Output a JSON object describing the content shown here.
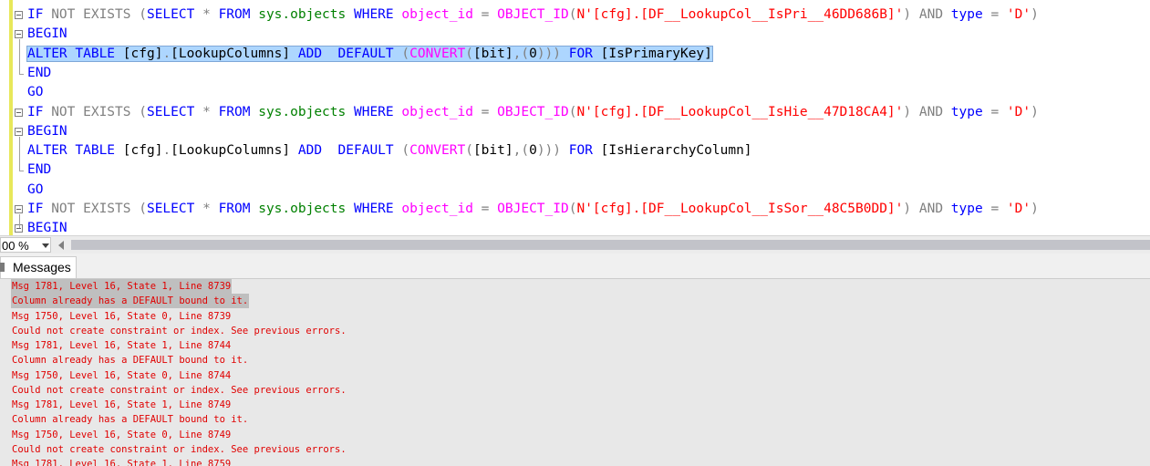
{
  "editor": {
    "lines": [
      {
        "indent": 0,
        "fold": true,
        "tokens": [
          {
            "t": "IF",
            "c": "kw"
          },
          {
            "t": " NOT EXISTS ",
            "c": "gr"
          },
          {
            "t": "(",
            "c": "gr"
          },
          {
            "t": "SELECT",
            "c": "kw"
          },
          {
            "t": " * ",
            "c": "gr"
          },
          {
            "t": "FROM",
            "c": "kw"
          },
          {
            "t": " ",
            "c": "bl"
          },
          {
            "t": "sys.objects",
            "c": "sy"
          },
          {
            "t": " ",
            "c": "bl"
          },
          {
            "t": "WHERE",
            "c": "kw"
          },
          {
            "t": " ",
            "c": "bl"
          },
          {
            "t": "object_id",
            "c": "fn"
          },
          {
            "t": " = ",
            "c": "gr"
          },
          {
            "t": "OBJECT_ID",
            "c": "fn"
          },
          {
            "t": "(",
            "c": "gr"
          },
          {
            "t": "N'[cfg].[DF__LookupCol__IsPri__46DD686B]'",
            "c": "st"
          },
          {
            "t": ") ",
            "c": "gr"
          },
          {
            "t": "AND",
            "c": "gr"
          },
          {
            "t": " ",
            "c": "bl"
          },
          {
            "t": "type",
            "c": "kw"
          },
          {
            "t": " = ",
            "c": "gr"
          },
          {
            "t": "'D'",
            "c": "st"
          },
          {
            "t": ")",
            "c": "gr"
          }
        ]
      },
      {
        "indent": 0,
        "fold": true,
        "tokens": [
          {
            "t": "BEGIN",
            "c": "kw"
          }
        ]
      },
      {
        "indent": 0,
        "fold": false,
        "selected": true,
        "tokens": [
          {
            "t": "ALTER",
            "c": "kw"
          },
          {
            "t": " ",
            "c": "bl"
          },
          {
            "t": "TABLE",
            "c": "kw"
          },
          {
            "t": " [cfg]",
            "c": "bl"
          },
          {
            "t": ".",
            "c": "gr"
          },
          {
            "t": "[LookupColumns] ",
            "c": "bl"
          },
          {
            "t": "ADD",
            "c": "kw"
          },
          {
            "t": "  ",
            "c": "bl"
          },
          {
            "t": "DEFAULT",
            "c": "kw"
          },
          {
            "t": " ",
            "c": "bl"
          },
          {
            "t": "(",
            "c": "gr"
          },
          {
            "t": "CONVERT",
            "c": "fn"
          },
          {
            "t": "(",
            "c": "gr"
          },
          {
            "t": "[bit]",
            "c": "bl"
          },
          {
            "t": ",(",
            "c": "gr"
          },
          {
            "t": "0",
            "c": "bl"
          },
          {
            "t": "))) ",
            "c": "gr"
          },
          {
            "t": "FOR",
            "c": "kw"
          },
          {
            "t": " [IsPrimaryKey]",
            "c": "bl"
          }
        ]
      },
      {
        "indent": 0,
        "fold": false,
        "tokens": [
          {
            "t": "END",
            "c": "kw"
          }
        ]
      },
      {
        "indent": 0,
        "fold": false,
        "tokens": [
          {
            "t": "GO",
            "c": "kw"
          }
        ]
      },
      {
        "indent": 0,
        "fold": true,
        "tokens": [
          {
            "t": "IF",
            "c": "kw"
          },
          {
            "t": " NOT EXISTS ",
            "c": "gr"
          },
          {
            "t": "(",
            "c": "gr"
          },
          {
            "t": "SELECT",
            "c": "kw"
          },
          {
            "t": " * ",
            "c": "gr"
          },
          {
            "t": "FROM",
            "c": "kw"
          },
          {
            "t": " ",
            "c": "bl"
          },
          {
            "t": "sys.objects",
            "c": "sy"
          },
          {
            "t": " ",
            "c": "bl"
          },
          {
            "t": "WHERE",
            "c": "kw"
          },
          {
            "t": " ",
            "c": "bl"
          },
          {
            "t": "object_id",
            "c": "fn"
          },
          {
            "t": " = ",
            "c": "gr"
          },
          {
            "t": "OBJECT_ID",
            "c": "fn"
          },
          {
            "t": "(",
            "c": "gr"
          },
          {
            "t": "N'[cfg].[DF__LookupCol__IsHie__47D18CA4]'",
            "c": "st"
          },
          {
            "t": ") ",
            "c": "gr"
          },
          {
            "t": "AND",
            "c": "gr"
          },
          {
            "t": " ",
            "c": "bl"
          },
          {
            "t": "type",
            "c": "kw"
          },
          {
            "t": " = ",
            "c": "gr"
          },
          {
            "t": "'D'",
            "c": "st"
          },
          {
            "t": ")",
            "c": "gr"
          }
        ]
      },
      {
        "indent": 0,
        "fold": true,
        "tokens": [
          {
            "t": "BEGIN",
            "c": "kw"
          }
        ]
      },
      {
        "indent": 0,
        "fold": false,
        "tokens": [
          {
            "t": "ALTER",
            "c": "kw"
          },
          {
            "t": " ",
            "c": "bl"
          },
          {
            "t": "TABLE",
            "c": "kw"
          },
          {
            "t": " [cfg]",
            "c": "bl"
          },
          {
            "t": ".",
            "c": "gr"
          },
          {
            "t": "[LookupColumns] ",
            "c": "bl"
          },
          {
            "t": "ADD",
            "c": "kw"
          },
          {
            "t": "  ",
            "c": "bl"
          },
          {
            "t": "DEFAULT",
            "c": "kw"
          },
          {
            "t": " ",
            "c": "bl"
          },
          {
            "t": "(",
            "c": "gr"
          },
          {
            "t": "CONVERT",
            "c": "fn"
          },
          {
            "t": "(",
            "c": "gr"
          },
          {
            "t": "[bit]",
            "c": "bl"
          },
          {
            "t": ",(",
            "c": "gr"
          },
          {
            "t": "0",
            "c": "bl"
          },
          {
            "t": "))) ",
            "c": "gr"
          },
          {
            "t": "FOR",
            "c": "kw"
          },
          {
            "t": " [IsHierarchyColumn]",
            "c": "bl"
          }
        ]
      },
      {
        "indent": 0,
        "fold": false,
        "tokens": [
          {
            "t": "END",
            "c": "kw"
          }
        ]
      },
      {
        "indent": 0,
        "fold": false,
        "tokens": [
          {
            "t": "GO",
            "c": "kw"
          }
        ]
      },
      {
        "indent": 0,
        "fold": true,
        "tokens": [
          {
            "t": "IF",
            "c": "kw"
          },
          {
            "t": " NOT EXISTS ",
            "c": "gr"
          },
          {
            "t": "(",
            "c": "gr"
          },
          {
            "t": "SELECT",
            "c": "kw"
          },
          {
            "t": " * ",
            "c": "gr"
          },
          {
            "t": "FROM",
            "c": "kw"
          },
          {
            "t": " ",
            "c": "bl"
          },
          {
            "t": "sys.objects",
            "c": "sy"
          },
          {
            "t": " ",
            "c": "bl"
          },
          {
            "t": "WHERE",
            "c": "kw"
          },
          {
            "t": " ",
            "c": "bl"
          },
          {
            "t": "object_id",
            "c": "fn"
          },
          {
            "t": " = ",
            "c": "gr"
          },
          {
            "t": "OBJECT_ID",
            "c": "fn"
          },
          {
            "t": "(",
            "c": "gr"
          },
          {
            "t": "N'[cfg].[DF__LookupCol__IsSor__48C5B0DD]'",
            "c": "st"
          },
          {
            "t": ") ",
            "c": "gr"
          },
          {
            "t": "AND",
            "c": "gr"
          },
          {
            "t": " ",
            "c": "bl"
          },
          {
            "t": "type",
            "c": "kw"
          },
          {
            "t": " = ",
            "c": "gr"
          },
          {
            "t": "'D'",
            "c": "st"
          },
          {
            "t": ")",
            "c": "gr"
          }
        ]
      },
      {
        "indent": 0,
        "fold": true,
        "tokens": [
          {
            "t": "BEGIN",
            "c": "kw"
          }
        ]
      }
    ],
    "colors": {
      "keyword": "#0000ff",
      "gray": "#808080",
      "function": "#ff00ff",
      "system": "#008000",
      "string": "#ff0000",
      "selection": "#add6ff",
      "margin": "#e8e85a"
    }
  },
  "statusbar": {
    "zoom": "00 %"
  },
  "results": {
    "tab_label": "Messages",
    "messages": [
      {
        "text": "Msg 1781, Level 16, State 1, Line 8739",
        "highlight": true
      },
      {
        "text": "Column already has a DEFAULT bound to it.",
        "highlight": true
      },
      {
        "text": "Msg 1750, Level 16, State 0, Line 8739"
      },
      {
        "text": "Could not create constraint or index. See previous errors."
      },
      {
        "text": "Msg 1781, Level 16, State 1, Line 8744"
      },
      {
        "text": "Column already has a DEFAULT bound to it."
      },
      {
        "text": "Msg 1750, Level 16, State 0, Line 8744"
      },
      {
        "text": "Could not create constraint or index. See previous errors."
      },
      {
        "text": "Msg 1781, Level 16, State 1, Line 8749"
      },
      {
        "text": "Column already has a DEFAULT bound to it."
      },
      {
        "text": "Msg 1750, Level 16, State 0, Line 8749"
      },
      {
        "text": "Could not create constraint or index. See previous errors."
      },
      {
        "text": "Msg 1781, Level 16, State 1, Line 8759"
      }
    ],
    "message_color": "#e00000"
  }
}
